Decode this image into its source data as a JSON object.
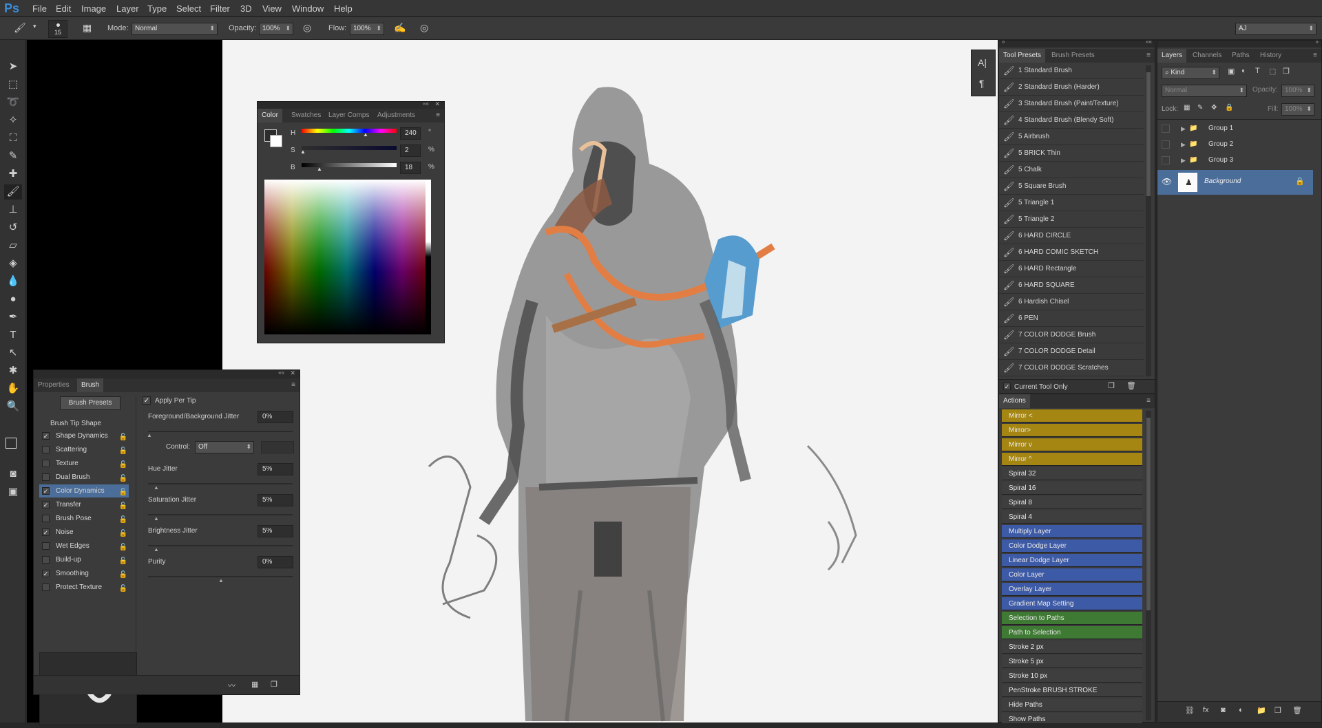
{
  "app": {
    "logo": "Ps"
  },
  "menu": [
    "File",
    "Edit",
    "Image",
    "Layer",
    "Type",
    "Select",
    "Filter",
    "3D",
    "View",
    "Window",
    "Help"
  ],
  "options": {
    "brush_size": "15",
    "mode_label": "Mode:",
    "mode_value": "Normal",
    "opacity_label": "Opacity:",
    "opacity_value": "100%",
    "flow_label": "Flow:",
    "flow_value": "100%",
    "workspace": "AJ"
  },
  "color_panel": {
    "tabs": [
      "Color",
      "Swatches",
      "Layer Comps",
      "Adjustments"
    ],
    "h_label": "H",
    "s_label": "S",
    "b_label": "B",
    "h": "240",
    "s": "2",
    "b": "18",
    "h_unit": "°",
    "s_unit": "%",
    "b_unit": "%"
  },
  "brush_panel": {
    "tabs": [
      "Properties",
      "Brush"
    ],
    "presets_button": "Brush Presets",
    "tip_shape": "Brush Tip Shape",
    "items": [
      {
        "label": "Shape Dynamics",
        "checked": true
      },
      {
        "label": "Scattering",
        "checked": false
      },
      {
        "label": "Texture",
        "checked": false
      },
      {
        "label": "Dual Brush",
        "checked": false
      },
      {
        "label": "Color Dynamics",
        "checked": true
      },
      {
        "label": "Transfer",
        "checked": true
      },
      {
        "label": "Brush Pose",
        "checked": false
      },
      {
        "label": "Noise",
        "checked": true
      },
      {
        "label": "Wet Edges",
        "checked": false
      },
      {
        "label": "Build-up",
        "checked": false
      },
      {
        "label": "Smoothing",
        "checked": true
      },
      {
        "label": "Protect Texture",
        "checked": false
      }
    ],
    "apply_per_tip": "Apply Per Tip",
    "fg_bg_jitter": "Foreground/Background Jitter",
    "fg_bg_value": "0%",
    "control_label": "Control:",
    "control_value": "Off",
    "hue_jitter": "Hue Jitter",
    "hue_value": "5%",
    "sat_jitter": "Saturation Jitter",
    "sat_value": "5%",
    "bright_jitter": "Brightness Jitter",
    "bright_value": "5%",
    "purity": "Purity",
    "purity_value": "0%"
  },
  "tool_presets": {
    "tabs": [
      "Tool Presets",
      "Brush Presets"
    ],
    "items": [
      "1 Standard Brush",
      "2 Standard Brush (Harder)",
      "3 Standard Brush (Paint/Texture)",
      "4 Standard Brush (Blendy Soft)",
      "5 Airbrush",
      "5 BRICK Thin",
      "5 Chalk",
      "5 Square Brush",
      "5 Triangle 1",
      "5 Triangle 2",
      "6 HARD CIRCLE",
      "6 HARD COMIC SKETCH",
      "6 HARD Rectangle",
      "6 HARD SQUARE",
      "6 Hardish Chisel",
      "6 PEN",
      "7 COLOR DODGE Brush",
      "7 COLOR DODGE Detail",
      "7 COLOR DODGE Scratches"
    ],
    "current_tool_only": "Current Tool Only"
  },
  "actions": {
    "title": "Actions",
    "items": [
      {
        "label": "Mirror <",
        "color": "#a58612"
      },
      {
        "label": "Mirror>",
        "color": "#a58612"
      },
      {
        "label": "Mirror v",
        "color": "#a58612"
      },
      {
        "label": "Mirror ^",
        "color": "#a58612"
      },
      {
        "label": "Spiral 32",
        "color": "#3e3e3e"
      },
      {
        "label": "Spiral 16",
        "color": "#3e3e3e"
      },
      {
        "label": "Spiral 8",
        "color": "#3e3e3e"
      },
      {
        "label": "Spiral 4",
        "color": "#3e3e3e"
      },
      {
        "label": "Multiply Layer",
        "color": "#3d5aa6"
      },
      {
        "label": "Color Dodge Layer",
        "color": "#3d5aa6"
      },
      {
        "label": "Linear Dodge Layer",
        "color": "#3d5aa6"
      },
      {
        "label": "Color Layer",
        "color": "#3d5aa6"
      },
      {
        "label": "Overlay Layer",
        "color": "#3d5aa6"
      },
      {
        "label": "Gradient Map Setting",
        "color": "#3d5aa6"
      },
      {
        "label": "Selection to Paths",
        "color": "#3f7a34"
      },
      {
        "label": "Path to Selection",
        "color": "#3f7a34"
      },
      {
        "label": "Stroke 2 px",
        "color": "#3e3e3e"
      },
      {
        "label": "Stroke 5 px",
        "color": "#3e3e3e"
      },
      {
        "label": "Stroke 10 px",
        "color": "#3e3e3e"
      },
      {
        "label": "PenStroke BRUSH STROKE",
        "color": "#3e3e3e"
      },
      {
        "label": "Hide Paths",
        "color": "#3e3e3e"
      },
      {
        "label": "Show Paths",
        "color": "#3e3e3e"
      }
    ]
  },
  "layers": {
    "tabs": [
      "Layers",
      "Channels",
      "Paths",
      "History"
    ],
    "kind": "Kind",
    "blend": "Normal",
    "opacity_label": "Opacity:",
    "opacity": "100%",
    "lock_label": "Lock:",
    "fill_label": "Fill:",
    "fill": "100%",
    "items": [
      "Group 1",
      "Group 2",
      "Group 3"
    ],
    "background": "Background"
  }
}
